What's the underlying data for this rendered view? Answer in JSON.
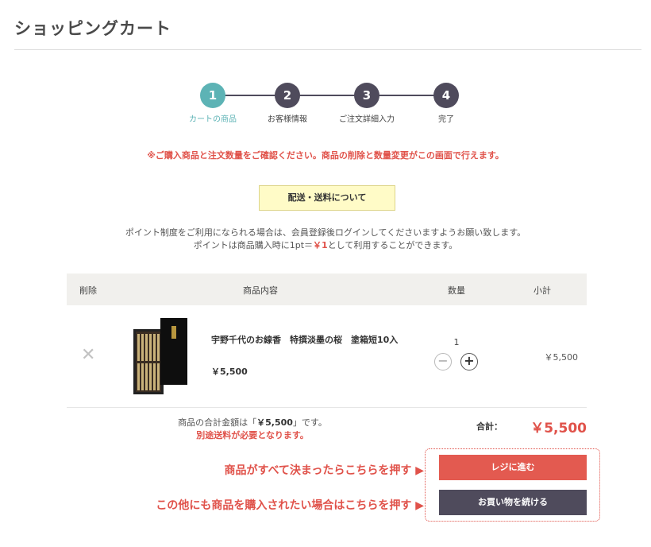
{
  "page": {
    "title": "ショッピングカート"
  },
  "steps": [
    {
      "num": "1",
      "label": "カートの商品",
      "active": true
    },
    {
      "num": "2",
      "label": "お客様情報",
      "active": false
    },
    {
      "num": "3",
      "label": "ご注文詳細入力",
      "active": false
    },
    {
      "num": "4",
      "label": "完了",
      "active": false
    }
  ],
  "notice": "※ご購入商品と注文数量をご確認ください。商品の削除と数量変更がこの画面で行えます。",
  "shipping_button": "配送・送料について",
  "points": {
    "line1": "ポイント制度をご利用になられる場合は、会員登録後ログインしてくださいますようお願い致します。",
    "line2_prefix": "ポイントは商品購入時に1pt＝",
    "line2_highlight": "￥1",
    "line2_suffix": "として利用することができます。"
  },
  "table": {
    "headers": {
      "remove": "削除",
      "product": "商品内容",
      "quantity": "数量",
      "subtotal": "小計"
    }
  },
  "items": [
    {
      "remove_icon": "close-icon",
      "name": "宇野千代のお線香　特撰淡墨の桜　塗箱短10入",
      "price": "￥5,500",
      "quantity": "1",
      "subtotal": "￥5,500"
    }
  ],
  "summary": {
    "text_prefix": "商品の合計金額は「",
    "text_amount": "￥5,500",
    "text_suffix": "」です。",
    "shipping_note": "別途送料が必要となります。",
    "total_label": "合計：",
    "total_amount": "￥5,500"
  },
  "buttons": {
    "checkout": "レジに進む",
    "continue": "お買い物を続ける"
  },
  "guides": {
    "checkout": "商品がすべて決まったらこちらを押す ▶",
    "continue": "この他にも商品を購入されたい場合はこちらを押す ▶"
  },
  "colors": {
    "accent_red": "#e0524a",
    "active_step": "#5db3b5",
    "step_default": "#4f4b5c",
    "checkout_button": "#e35a50",
    "continue_button": "#4f4b5c",
    "shipping_button_bg": "#fffbc7"
  }
}
